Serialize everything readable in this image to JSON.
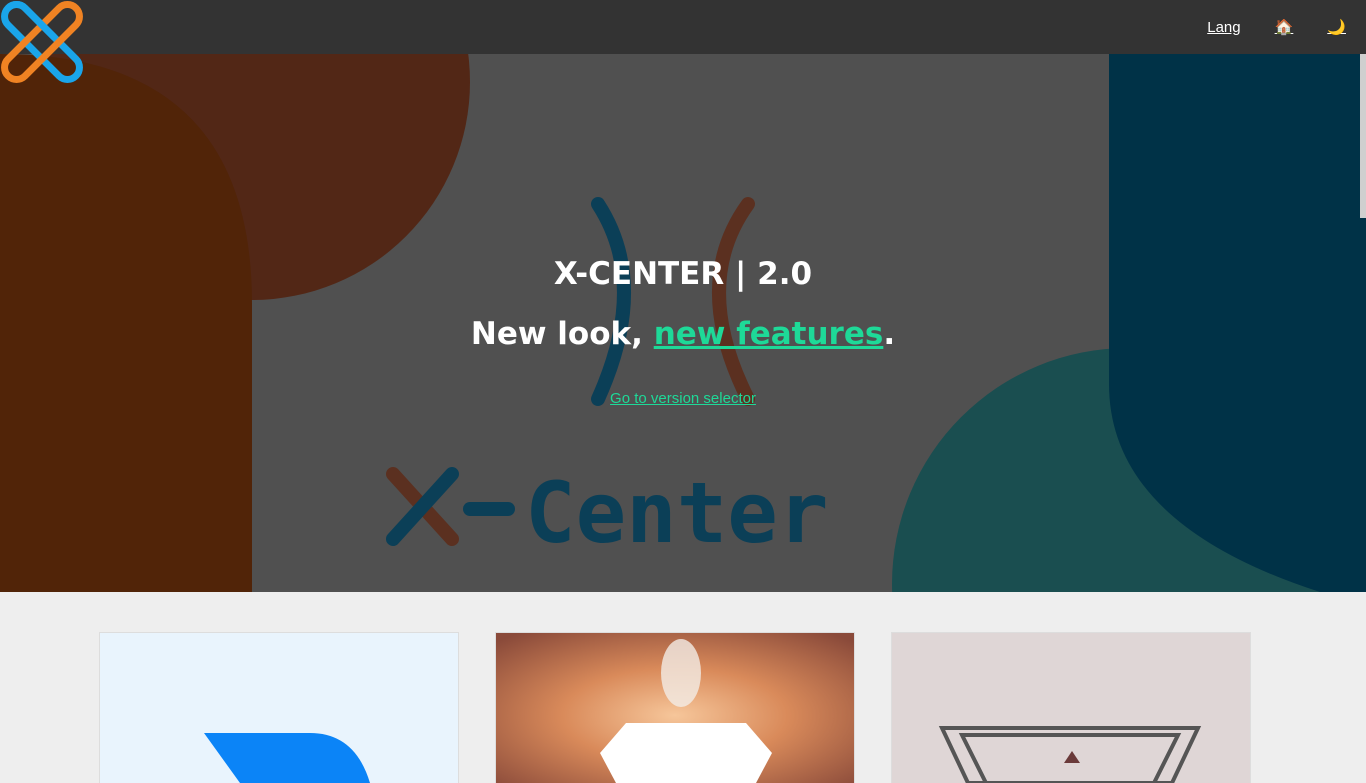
{
  "nav": {
    "lang_label": "Lang",
    "home_icon": "house-icon",
    "home_glyph": "🏠",
    "theme_icon": "crescent-moon-icon",
    "theme_glyph": "🌙"
  },
  "hero": {
    "title": "X-CENTER | 2.0",
    "subtitle_prefix": "New look, ",
    "subtitle_accent": "new features",
    "subtitle_suffix": ".",
    "version_link": "Go to version selector",
    "watermark": "X-Center"
  },
  "colors": {
    "nav_bg": "#333333",
    "hero_bg": "#505050",
    "accent": "#1ed998",
    "logo_blue": "#1aa5ea",
    "logo_orange": "#f08323"
  },
  "cards": [
    {
      "name": "card-app-1",
      "icon": "blue-arrow-logo"
    },
    {
      "name": "card-app-2",
      "icon": "white-diamond-logo"
    },
    {
      "name": "card-app-3",
      "icon": "triangle-logo"
    }
  ]
}
